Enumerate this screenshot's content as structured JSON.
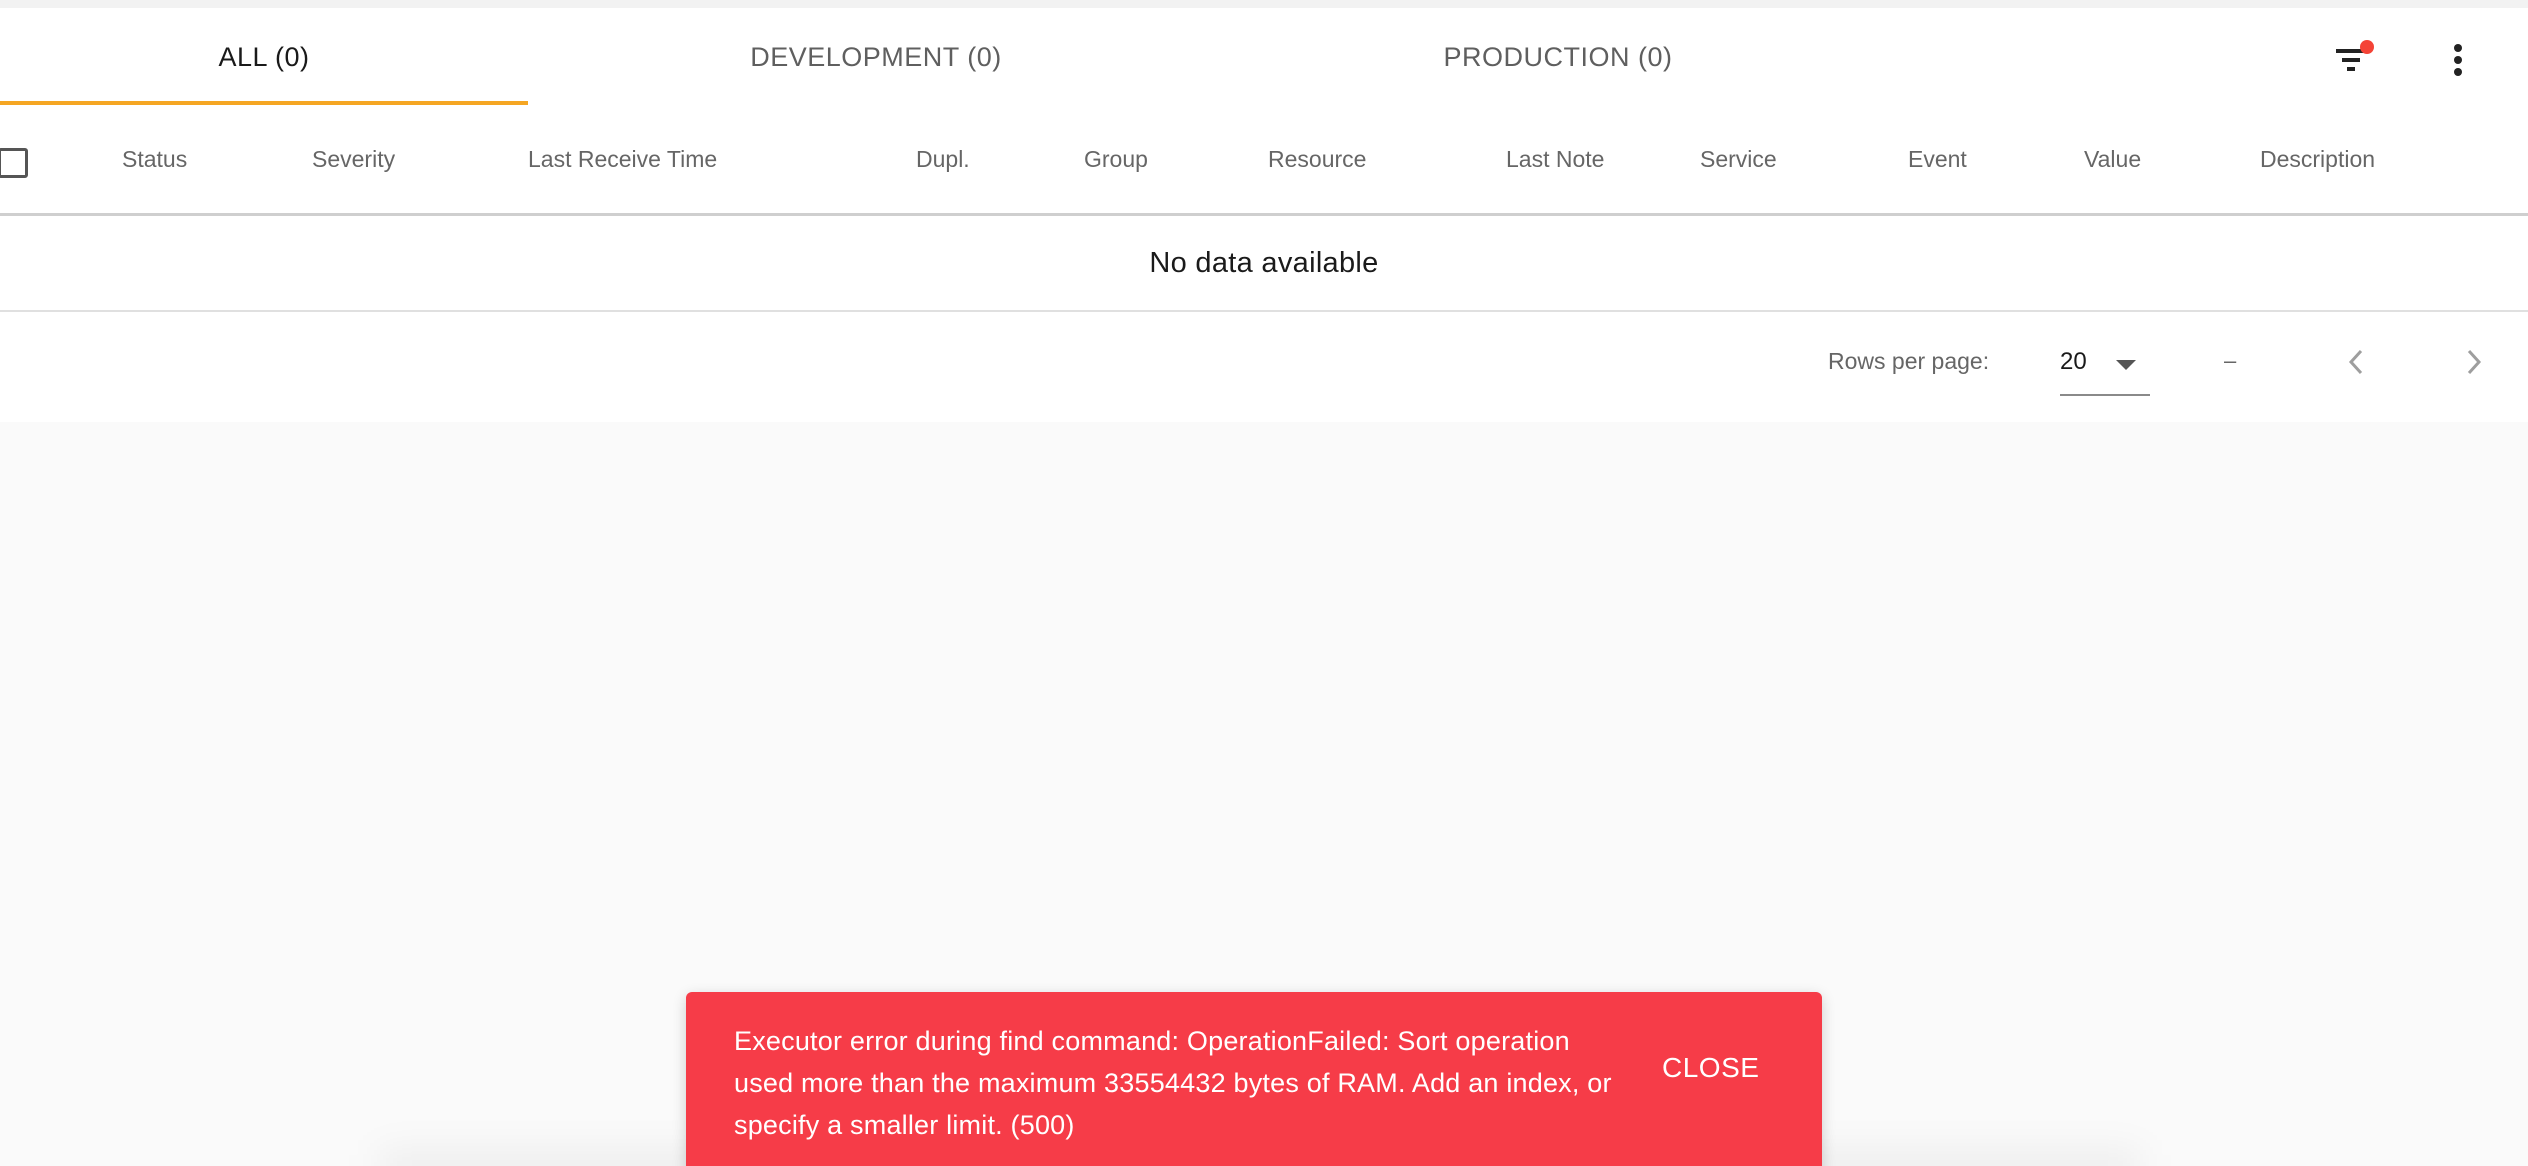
{
  "tabs": [
    {
      "label": "ALL (0)",
      "active": true
    },
    {
      "label": "DEVELOPMENT (0)",
      "active": false
    },
    {
      "label": "PRODUCTION (0)",
      "active": false
    }
  ],
  "toolbar": {
    "filter_icon": "filter-list-icon",
    "filter_badge_color": "#f44336",
    "more_icon": "more-vert-icon"
  },
  "table": {
    "columns": [
      "Status",
      "Severity",
      "Last Receive Time",
      "Dupl.",
      "Group",
      "Resource",
      "Last Note",
      "Service",
      "Event",
      "Value",
      "Description"
    ],
    "empty_text": "No data available"
  },
  "pagination": {
    "rows_per_page_label": "Rows per page:",
    "rows_per_page_value": "20",
    "range_text": "–"
  },
  "snackbar": {
    "message": "Executor error during find command: OperationFailed: Sort operation used more than the maximum 33554432 bytes of RAM. Add an index, or specify a smaller limit. (500)",
    "close_label": "CLOSE",
    "background": "#f63c48"
  },
  "colors": {
    "accent": "#f5a623",
    "error": "#f63c48"
  }
}
